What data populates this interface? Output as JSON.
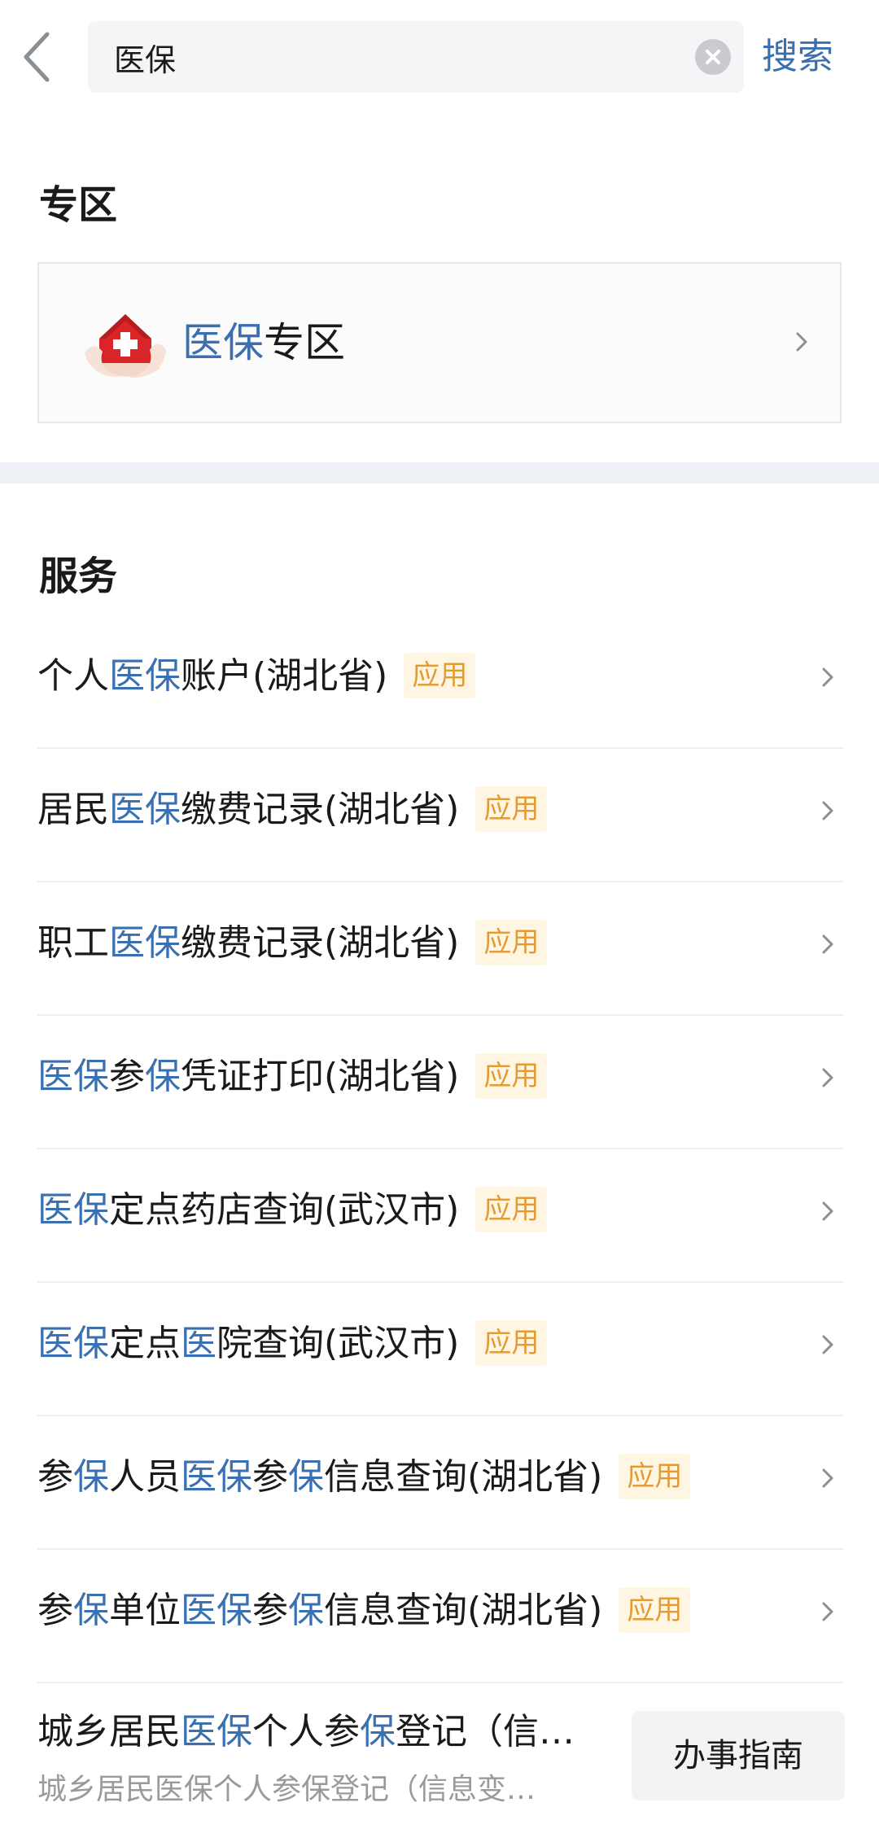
{
  "search": {
    "back_icon": "chevron-left-icon",
    "value": "医保",
    "clear_icon": "clear-circle-icon",
    "search_label": "搜索"
  },
  "zone": {
    "heading": "专区",
    "card": {
      "title_highlight": "医保",
      "title_rest": "专区",
      "logo_icon": "hands-red-cross-house-icon",
      "chevron_icon": "chevron-right-icon"
    }
  },
  "services": {
    "heading": "服务",
    "items": [
      {
        "parts": [
          "个人",
          "医保",
          "账户(湖北省)"
        ],
        "badge": "应用"
      },
      {
        "parts": [
          "居民",
          "医保",
          "缴费记录(湖北省)"
        ],
        "badge": "应用"
      },
      {
        "parts": [
          "职工",
          "医保",
          "缴费记录(湖北省)"
        ],
        "badge": "应用"
      },
      {
        "parts": [
          "",
          "医保",
          "参",
          "保",
          "凭证打印(湖北省)"
        ],
        "badge": "应用"
      },
      {
        "parts": [
          "",
          "医保",
          "定点药店查询(武汉市)"
        ],
        "badge": "应用"
      },
      {
        "parts": [
          "",
          "医保",
          "定点",
          "医",
          "院查询(武汉市)"
        ],
        "badge": "应用"
      },
      {
        "parts": [
          "参",
          "保",
          "人员",
          "医保",
          "参",
          "保",
          "信息查询(湖北省)"
        ],
        "badge": "应用"
      },
      {
        "parts": [
          "参",
          "保",
          "单位",
          "医保",
          "参",
          "保",
          "信息查询(湖北省)"
        ],
        "badge": "应用"
      }
    ],
    "last": {
      "title_parts": [
        "城乡居民",
        "医保",
        "个人参",
        "保",
        "登记（信…"
      ],
      "subtitle": "城乡居民医保个人参保登记（信息变…",
      "guide_label": "办事指南"
    }
  }
}
